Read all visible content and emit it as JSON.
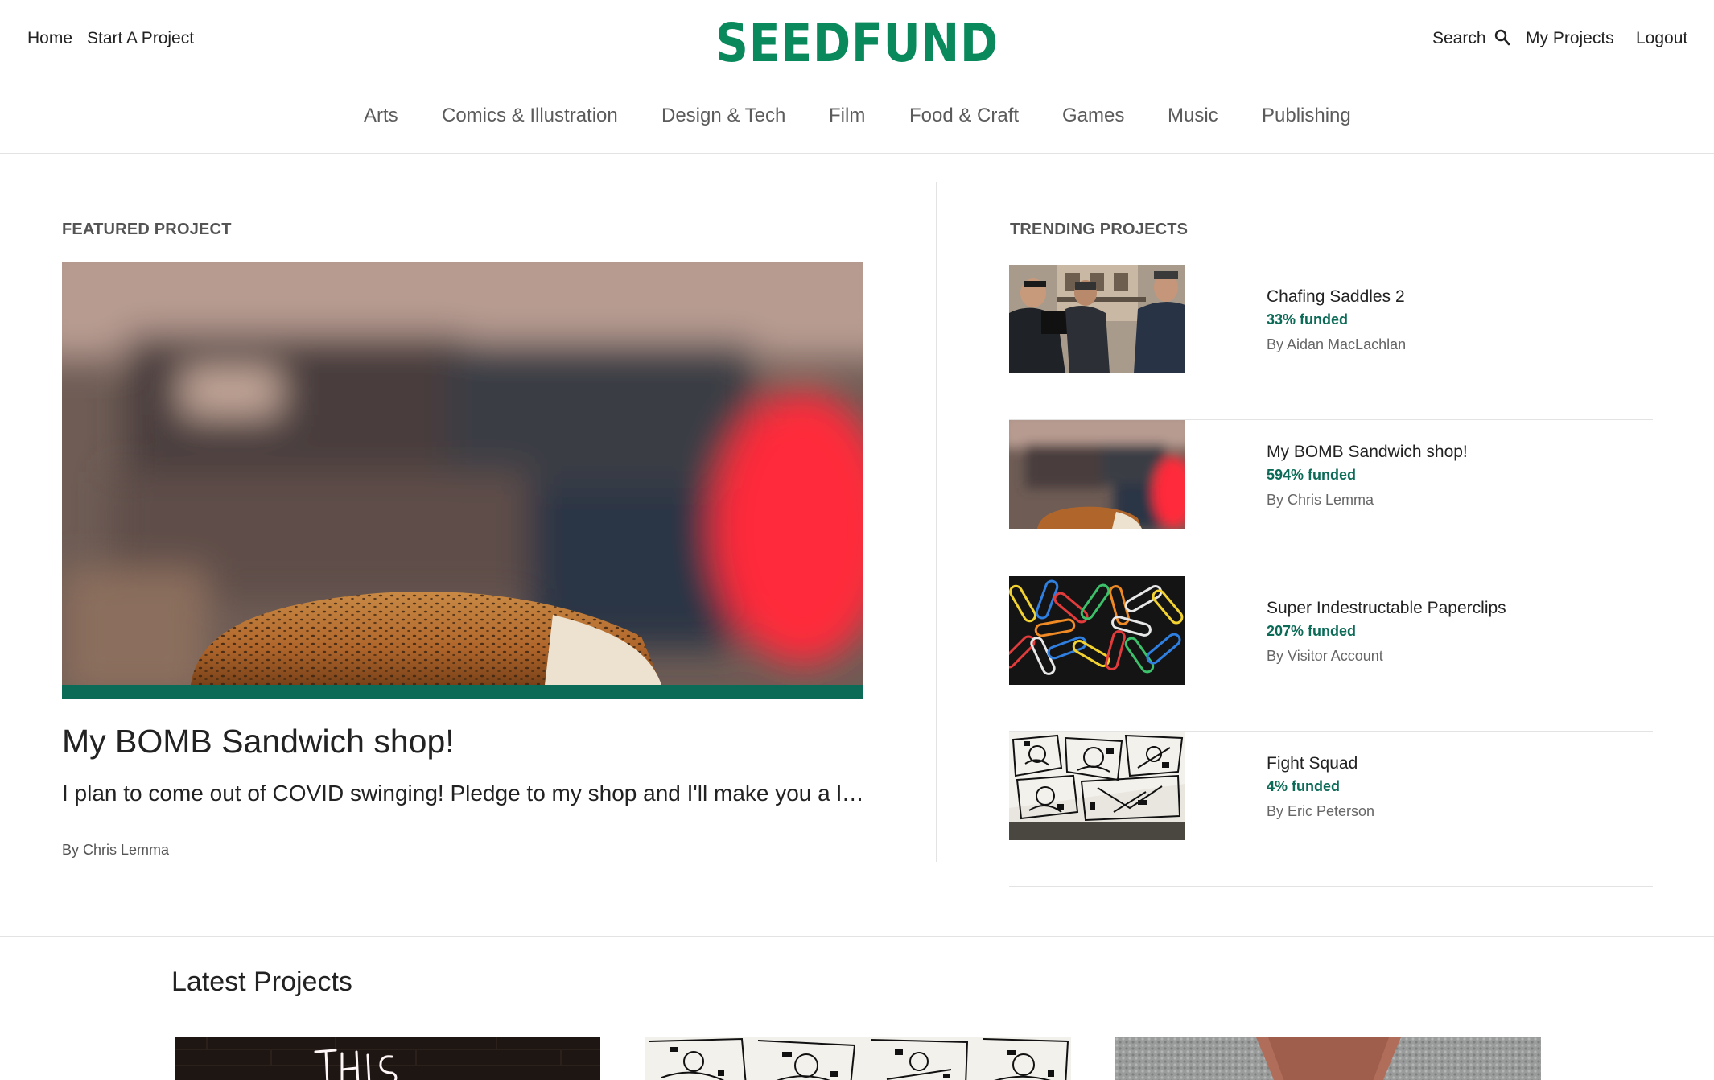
{
  "colors": {
    "brand": "#0a8a5c",
    "accent": "#0b6b57",
    "funded": "#0b6b57",
    "border": "#e3e3e3"
  },
  "header": {
    "logo_text": "SEEDFUND",
    "nav_left": [
      "Home",
      "Start A Project"
    ],
    "search_label": "Search",
    "search_icon": "search-icon",
    "nav_right": [
      "My Projects",
      "Logout"
    ]
  },
  "categories": [
    "Arts",
    "Comics & Illustration",
    "Design & Tech",
    "Film",
    "Food & Craft",
    "Games",
    "Music",
    "Publishing"
  ],
  "featured": {
    "label": "FEATURED PROJECT",
    "title": "My BOMB Sandwich shop!",
    "blurb": "I plan to come out of COVID swinging! Pledge to my shop and I'll make you a life…",
    "author": "By Chris Lemma",
    "image": "sandwich-photo"
  },
  "trending": {
    "label": "TRENDING PROJECTS",
    "items": [
      {
        "title": "Chafing Saddles 2",
        "funded": "33% funded",
        "author": "By Aidan MacLachlan",
        "image": "film-crew-photo"
      },
      {
        "title": "My BOMB Sandwich shop!",
        "funded": "594% funded",
        "author": "By Chris Lemma",
        "image": "sandwich-photo"
      },
      {
        "title": "Super Indestructable Paperclips",
        "funded": "207% funded",
        "author": "By Visitor Account",
        "image": "paperclips-photo"
      },
      {
        "title": "Fight Squad",
        "funded": "4% funded",
        "author": "By Eric Peterson",
        "image": "comic-art-photo"
      }
    ]
  },
  "latest": {
    "title": "Latest Projects",
    "cards": [
      {
        "image": "neon-sign-photo"
      },
      {
        "image": "comic-art-photo"
      },
      {
        "image": "fabric-photo"
      }
    ]
  }
}
